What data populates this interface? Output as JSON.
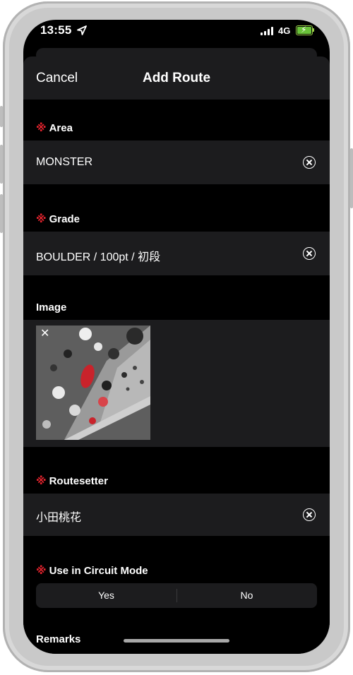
{
  "status_bar": {
    "time": "13:55",
    "network": "4G"
  },
  "nav": {
    "cancel_label": "Cancel",
    "title": "Add Route"
  },
  "required_mark": "※",
  "fields": {
    "area": {
      "label": "Area",
      "value": "MONSTER"
    },
    "grade": {
      "label": "Grade",
      "value": "BOULDER / 100pt / 初段"
    },
    "image": {
      "label": "Image",
      "remove_glyph": "✕"
    },
    "routesetter": {
      "label": "Routesetter",
      "value": "小田桃花"
    },
    "circuit": {
      "label": "Use in Circuit Mode",
      "options": [
        "Yes",
        "No"
      ]
    },
    "remarks": {
      "label": "Remarks"
    }
  },
  "icons": [
    "location-arrow-icon",
    "signal-icon",
    "battery-charging-icon",
    "clear-icon",
    "close-icon"
  ],
  "colors": {
    "required": "#e0232d",
    "background": "#000000",
    "row": "#1c1c1e",
    "battery": "#6ac23a"
  }
}
